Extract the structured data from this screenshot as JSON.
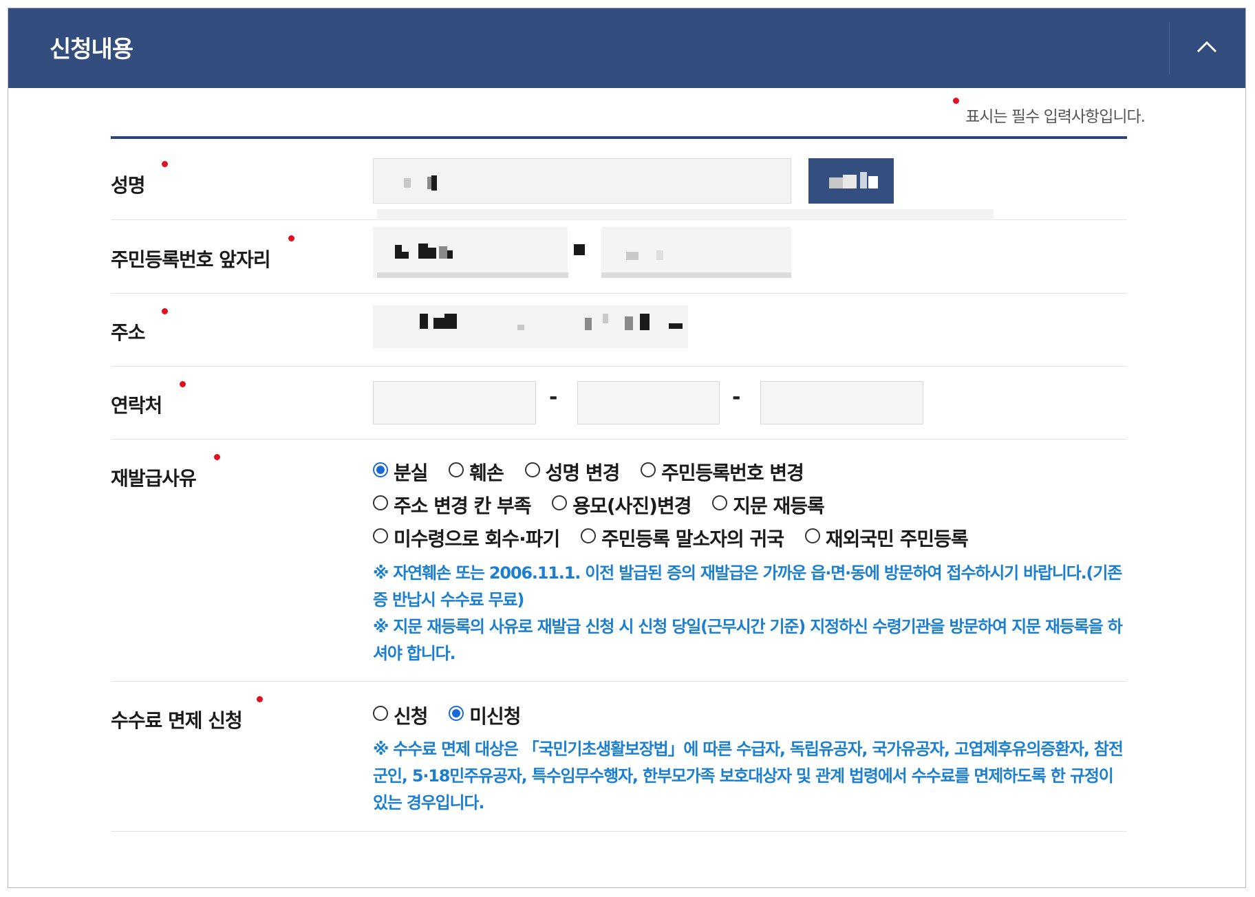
{
  "header": {
    "title": "신청내용",
    "collapse_icon": "chevron-up-icon"
  },
  "required_note": "표시는 필수 입력사항입니다.",
  "fields": {
    "name": {
      "label": "성명",
      "value": "",
      "button_label": ""
    },
    "rrn_front": {
      "label": "주민등록번호 앞자리",
      "separator": "-"
    },
    "address": {
      "label": "주소",
      "value": ""
    },
    "phone": {
      "label": "연락처",
      "sep1": "-",
      "sep2": "-",
      "part1": "",
      "part2": "",
      "part3": ""
    },
    "reissue_reason": {
      "label": "재발급사유",
      "options_row1": [
        "분실",
        "훼손",
        "성명 변경",
        "주민등록번호 변경"
      ],
      "options_row2": [
        "주소 변경 칸 부족",
        "용모(사진)변경",
        "지문 재등록"
      ],
      "options_row3": [
        "미수령으로 회수·파기",
        "주민등록 말소자의 귀국",
        "재외국민 주민등록"
      ],
      "selected": "분실",
      "note1": "※ 자연훼손 또는 2006.11.1. 이전 발급된 증의 재발급은 가까운 읍·면·동에 방문하여 접수하시기 바랍니다.(기존 증 반납시 수수료 무료)",
      "note2": "※ 지문 재등록의 사유로 재발급 신청 시 신청 당일(근무시간 기준) 지정하신 수령기관을 방문하여 지문 재등록을 하셔야 합니다."
    },
    "fee_exemption": {
      "label": "수수료 면제 신청",
      "options": [
        "신청",
        "미신청"
      ],
      "selected": "미신청",
      "note": "※ 수수료 면제 대상은 「국민기초생활보장법」에 따른 수급자, 독립유공자, 국가유공자, 고엽제후유의증환자, 참전군인, 5·18민주유공자, 특수임무수행자, 한부모가족 보호대상자 및 관계 법령에서 수수료를 면제하도록 한 규정이 있는 경우입니다."
    }
  },
  "colors": {
    "header_bg": "#334e7e",
    "accent": "#1769d8",
    "note_text": "#1a7fd0",
    "required_dot": "#e01020"
  }
}
